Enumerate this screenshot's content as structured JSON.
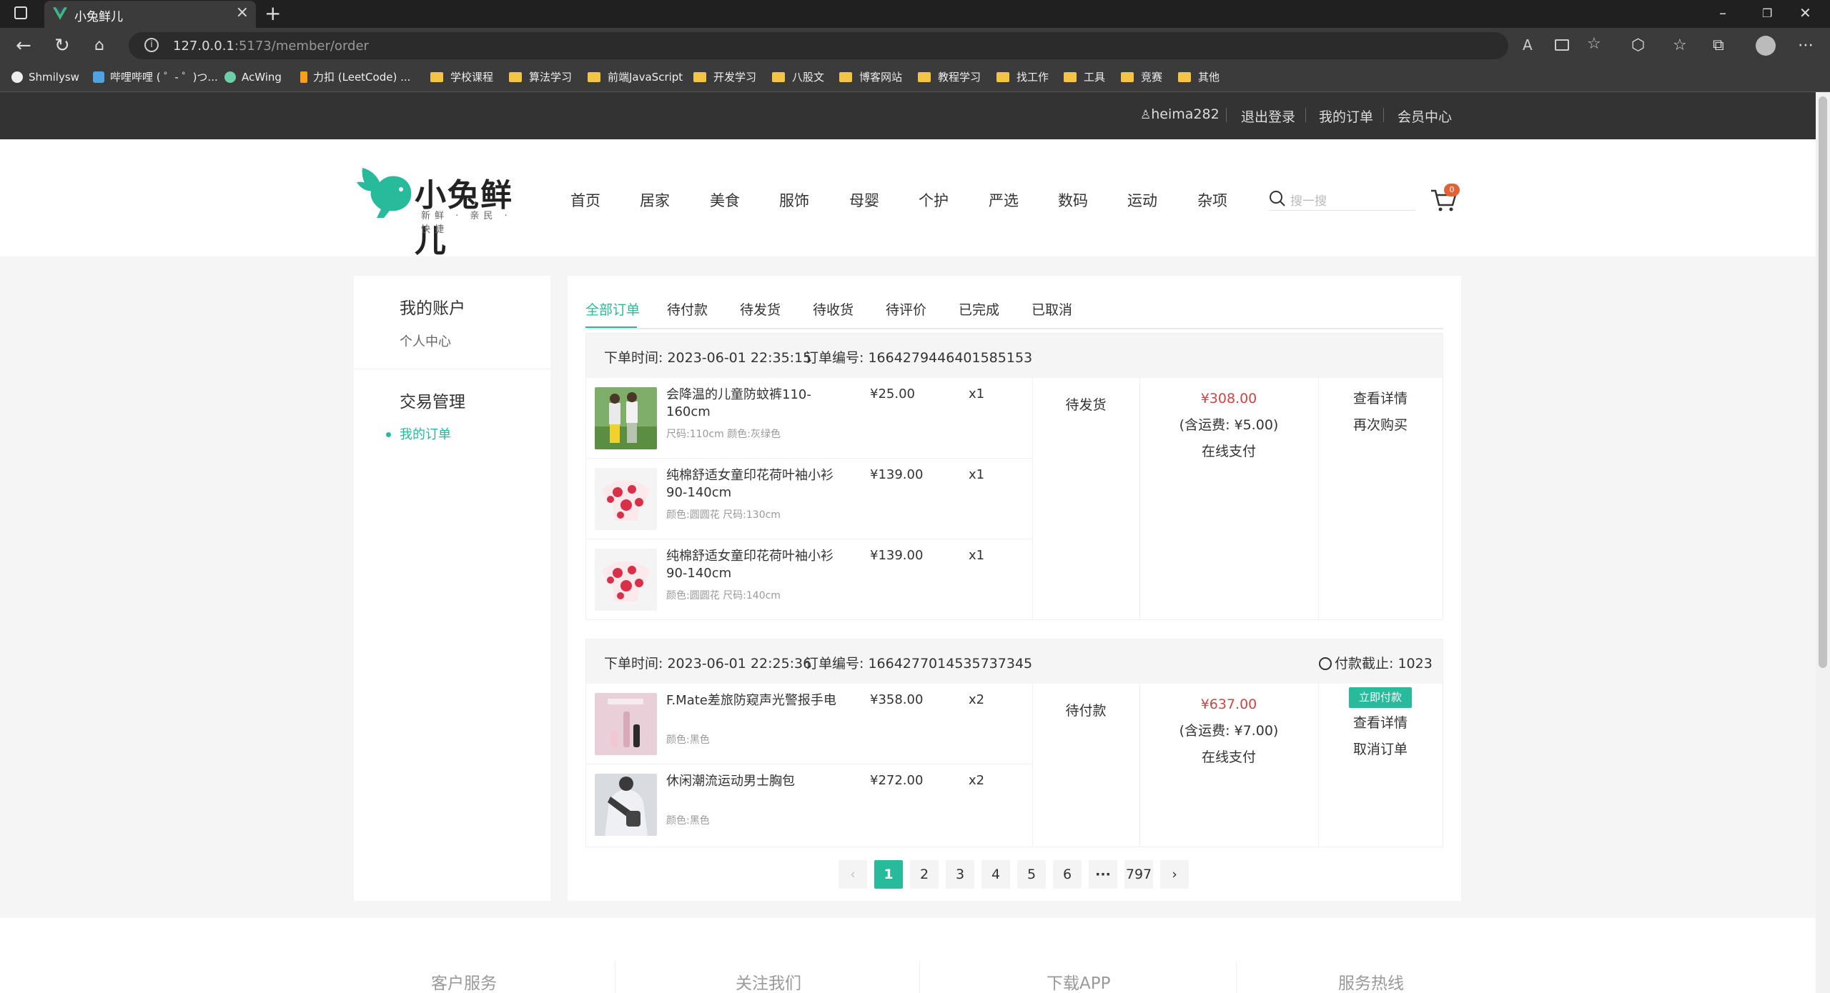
{
  "browser": {
    "tab_title": "小兔鲜儿",
    "url_host": "127.0.0.1",
    "url_path": ":5173/member/order",
    "bookmarks": [
      "Shmilysw",
      "哔哩哔哩 ( ゜- ゜)つ...",
      "AcWing",
      "力扣 (LeetCode) ...",
      "学校课程",
      "算法学习",
      "前端JavaScript",
      "开发学习",
      "八股文",
      "博客网站",
      "教程学习",
      "找工作",
      "工具",
      "竞赛",
      "其他"
    ]
  },
  "topnav": {
    "username": "heima282",
    "logout": "退出登录",
    "my_orders": "我的订单",
    "member_center": "会员中心"
  },
  "header": {
    "logo_text": "小兔鲜儿",
    "logo_sub": "新鲜 · 亲民 · 快捷",
    "nav": [
      "首页",
      "居家",
      "美食",
      "服饰",
      "母婴",
      "个护",
      "严选",
      "数码",
      "运动",
      "杂项"
    ],
    "search_placeholder": "搜一搜",
    "cart_count": "0"
  },
  "sidebar": {
    "section1_title": "我的账户",
    "section1_item": "个人中心",
    "section2_title": "交易管理",
    "section2_item": "我的订单"
  },
  "order_tabs": [
    "全部订单",
    "待付款",
    "待发货",
    "待收货",
    "待评价",
    "已完成",
    "已取消"
  ],
  "orders": [
    {
      "time_label": "下单时间: 2023-06-01 22:35:15",
      "no_label": "订单编号: 1664279446401585153",
      "items": [
        {
          "name": "会降温的儿童防蚊裤110-160cm",
          "attr": "尺码:110cm 颜色:灰绿色",
          "price": "¥25.00",
          "qty": "x1"
        },
        {
          "name": "纯棉舒适女童印花荷叶袖小衫90-140cm",
          "attr": "颜色:圆圆花 尺码:130cm",
          "price": "¥139.00",
          "qty": "x1"
        },
        {
          "name": "纯棉舒适女童印花荷叶袖小衫90-140cm",
          "attr": "颜色:圆圆花 尺码:140cm",
          "price": "¥139.00",
          "qty": "x1"
        }
      ],
      "status": "待发货",
      "total": "¥308.00",
      "freight": "(含运费: ¥5.00)",
      "pay_method": "在线支付",
      "actions": [
        "查看详情",
        "再次购买"
      ]
    },
    {
      "time_label": "下单时间: 2023-06-01 22:25:36",
      "no_label": "订单编号: 1664277014535737345",
      "countdown": "付款截止: 1023",
      "items": [
        {
          "name": "F.Mate差旅防窥声光警报手电",
          "attr": "颜色:黑色",
          "price": "¥358.00",
          "qty": "x2"
        },
        {
          "name": "休闲潮流运动男士胸包",
          "attr": "颜色:黑色",
          "price": "¥272.00",
          "qty": "x2"
        }
      ],
      "status": "待付款",
      "total": "¥637.00",
      "freight": "(含运费: ¥7.00)",
      "pay_method": "在线支付",
      "pay_button": "立即付款",
      "actions": [
        "查看详情",
        "取消订单"
      ]
    }
  ],
  "pagination": {
    "pages": [
      "1",
      "2",
      "3",
      "4",
      "5",
      "6"
    ],
    "ellipsis": "···",
    "last": "797",
    "current": "1"
  },
  "footer": {
    "cols": [
      "客户服务",
      "关注我们",
      "下载APP",
      "服务热线"
    ]
  },
  "colors": {
    "brand": "#27ba9b",
    "price": "#cf4444",
    "topbar": "#333333"
  }
}
